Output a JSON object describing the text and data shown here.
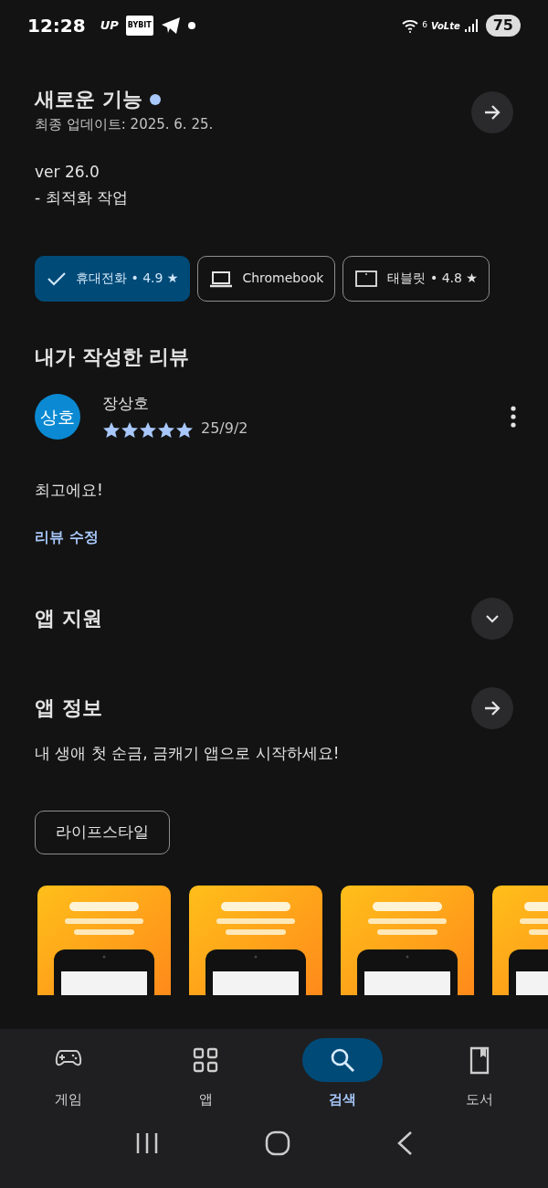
{
  "status_bar": {
    "time": "12:28",
    "app_badges": [
      "UP",
      "BYBIT"
    ],
    "wifi_label": "6",
    "network_label": "VoLte",
    "battery": "75"
  },
  "whats_new": {
    "title": "새로운 기능",
    "unread": true,
    "updated": "최종 업데이트: 2025. 6. 25.",
    "notes": [
      "ver 26.0",
      "- 최적화 작업"
    ]
  },
  "device_chips": [
    {
      "kind": "phone",
      "label": "휴대전화 • 4.9 ★",
      "selected": true
    },
    {
      "kind": "laptop",
      "label": "Chromebook",
      "selected": false
    },
    {
      "kind": "tablet",
      "label": "태블릿 • 4.8 ★",
      "selected": false
    }
  ],
  "my_review": {
    "title": "내가 작성한 리뷰",
    "avatar": "상호",
    "author": "장상호",
    "stars": 5,
    "date": "25/9/2",
    "text": "최고에요!",
    "edit_link": "리뷰 수정"
  },
  "app_support": {
    "title": "앱 지원",
    "expanded": false
  },
  "app_info": {
    "title": "앱 정보",
    "description": "내 생애 첫 순금, 금캐기 앱으로 시작하세요!",
    "category": "라이프스타일"
  },
  "bottom_nav": [
    {
      "kind": "games",
      "label": "게임",
      "selected": false
    },
    {
      "kind": "apps",
      "label": "앱",
      "selected": false
    },
    {
      "kind": "search",
      "label": "검색",
      "selected": true
    },
    {
      "kind": "books",
      "label": "도서",
      "selected": false
    }
  ]
}
